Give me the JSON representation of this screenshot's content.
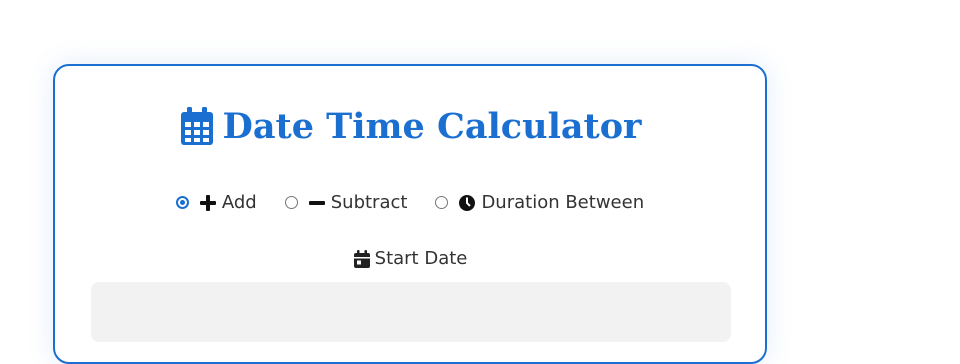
{
  "calculator": {
    "title": "Date Time Calculator",
    "title_icon": "calendar-icon",
    "accent_color": "#1a6fd1",
    "modes": [
      {
        "label": "Add",
        "icon": "plus-icon",
        "selected": true
      },
      {
        "label": "Subtract",
        "icon": "minus-icon",
        "selected": false
      },
      {
        "label": "Duration Between",
        "icon": "clock-icon",
        "selected": false
      }
    ],
    "start_date": {
      "label": "Start Date",
      "icon": "calendar-day-icon",
      "value": ""
    }
  }
}
